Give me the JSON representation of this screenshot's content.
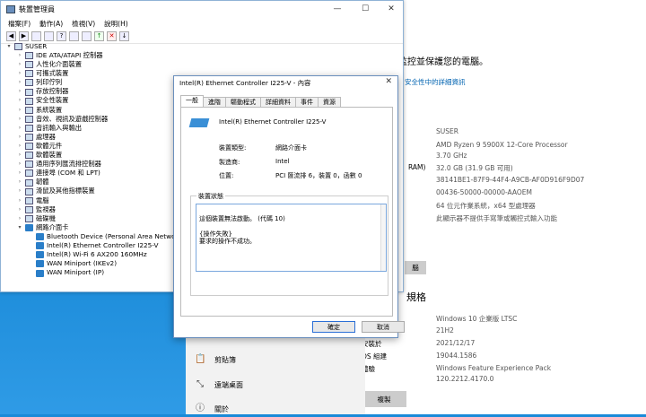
{
  "settings": {
    "protect_heading": "監控並保護您的電腦。",
    "security_link": "安全性中的詳細資訊",
    "specs": [
      {
        "label": "",
        "value": "SUSER"
      },
      {
        "label": "",
        "value": "AMD Ryzen 9 5900X 12-Core Processor"
      },
      {
        "label": "",
        "value": "3.70 GHz"
      },
      {
        "label": "RAM)",
        "value": "32.0 GB (31.9 GB 可用)"
      },
      {
        "label": "",
        "value": "38141BE1-87F9-44F4-A9CB-AF0D916F9D07"
      },
      {
        "label": "",
        "value": "00436-50000-00000-AAOEM"
      },
      {
        "label": "",
        "value": "64 位元作業系統，x64 型處理器"
      },
      {
        "label": "",
        "value": "此顯示器不提供手寫筆或觸控式輸入功能"
      }
    ],
    "rename_button": "腦",
    "windows_spec_heading": "規格",
    "win_specs": [
      {
        "label": "",
        "value": "Windows 10 企業版 LTSC"
      },
      {
        "label": "",
        "value": "21H2"
      },
      {
        "label": "安裝於",
        "value": "2021/12/17"
      },
      {
        "label": "OS 組建",
        "value": "19044.1586"
      },
      {
        "label": "體驗",
        "value": "Windows Feature Experience Pack"
      },
      {
        "label": "",
        "value": "120.2212.4170.0"
      }
    ],
    "copy_button": "複製",
    "nav": [
      "剪貼簿",
      "遠端桌面",
      "關於"
    ]
  },
  "devmgr": {
    "title": "裝置管理員",
    "menu": [
      "檔案(F)",
      "動作(A)",
      "檢視(V)",
      "說明(H)"
    ],
    "root": "SUSER",
    "items": [
      "IDE ATA/ATAPI 控制器",
      "人性化介面裝置",
      "可攜式裝置",
      "列印佇列",
      "存放控制器",
      "安全性裝置",
      "系統裝置",
      "音效、視訊及遊戲控制器",
      "音訊輸入與輸出",
      "處理器",
      "軟體元件",
      "軟體裝置",
      "通用序列匯流排控制器",
      "連接埠 (COM 和 LPT)",
      "韌體",
      "滑鼠及其他指標裝置",
      "電腦",
      "監視器",
      "磁碟機"
    ],
    "net_category": "網路介面卡",
    "net_items": [
      "Bluetooth Device (Personal Area Network)",
      "Intel(R) Ethernet Controller I225-V",
      "Intel(R) Wi-Fi 6 AX200 160MHz",
      "WAN Miniport (IKEv2)",
      "WAN Miniport (IP)"
    ]
  },
  "dialog": {
    "title": "Intel(R) Ethernet Controller I225-V - 內容",
    "tabs": [
      "一般",
      "進階",
      "驅動程式",
      "詳細資料",
      "事件",
      "資源"
    ],
    "device_name": "Intel(R) Ethernet Controller I225-V",
    "type_label": "裝置類型:",
    "type_value": "網路介面卡",
    "mfr_label": "製造商:",
    "mfr_value": "Intel",
    "loc_label": "位置:",
    "loc_value": "PCI 匯流排 6，裝置 0，函數 0",
    "status_group": "裝置狀態",
    "status_text": "這個裝置無法啟動。 (代碼 10)\n\n{操作失敗}\n要求的操作不成功。",
    "ok": "確定",
    "cancel": "取消"
  }
}
